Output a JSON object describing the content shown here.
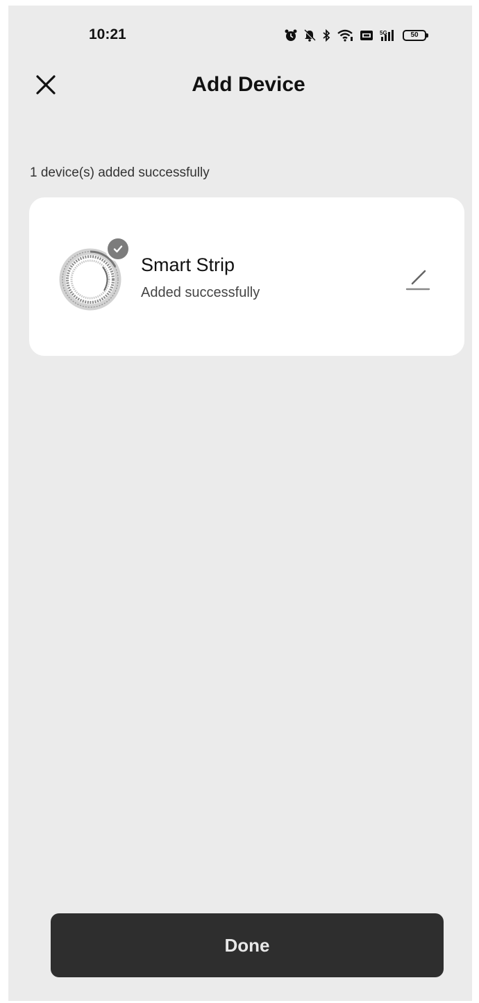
{
  "status_bar": {
    "time": "10:21",
    "battery": "50",
    "icons": [
      "alarm-icon",
      "mute-icon",
      "bluetooth-icon",
      "wifi-icon",
      "volte-icon",
      "cellular-signal-icon",
      "battery-icon"
    ]
  },
  "header": {
    "title": "Add Device",
    "close_icon": "close-icon"
  },
  "summary": {
    "text": "1 device(s) added successfully"
  },
  "devices": [
    {
      "name": "Smart Strip",
      "status": "Added successfully",
      "image_icon": "smart-strip-icon",
      "badge_icon": "check-icon",
      "edit_icon": "edit-icon"
    }
  ],
  "actions": {
    "done_label": "Done"
  },
  "colors": {
    "background": "#ebebeb",
    "card": "#ffffff",
    "button": "#2e2e2e",
    "button_text": "#e8e8e8",
    "badge": "#7c7c7c"
  }
}
